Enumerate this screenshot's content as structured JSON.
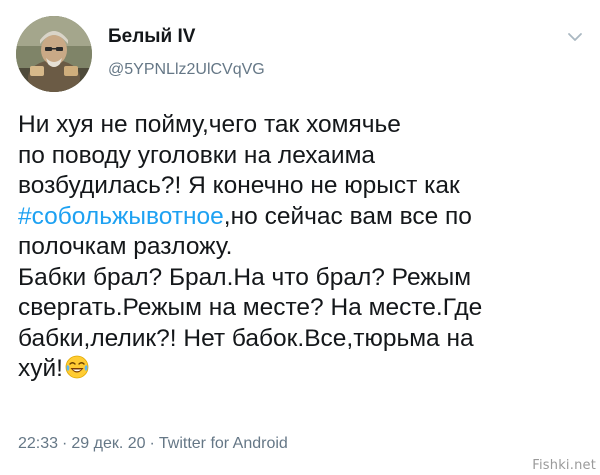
{
  "user": {
    "display_name": "Белый IV",
    "handle": "@5YPNLlz2UlCVqVG",
    "avatar_icon": "avatar-portrait"
  },
  "menu_icon": "chevron-down-icon",
  "tweet": {
    "lines": [
      "Ни хуя не пойму,чего так хомячье",
      "по поводу уголовки на лехаима",
      "возбудилась?! Я конечно не юрыст как",
      "",
      "полочкам разложу.",
      "Бабки брал? Брал.На что брал? Режым",
      "свергать.Режым на месте? На месте.Где",
      "бабки,лелик?! Нет бабок.Все,тюрьма на",
      "хуй!"
    ],
    "hashtag": "#собольжывотное",
    "hashtag_suffix": ",но сейчас вам все по",
    "emoji": "face-with-tears-of-joy-icon",
    "accent_color": "#1da1f2"
  },
  "meta": {
    "time": "22:33",
    "separator": "·",
    "date": "29 дек. 20",
    "source": "Twitter for Android"
  },
  "watermark": "Fishki.net"
}
